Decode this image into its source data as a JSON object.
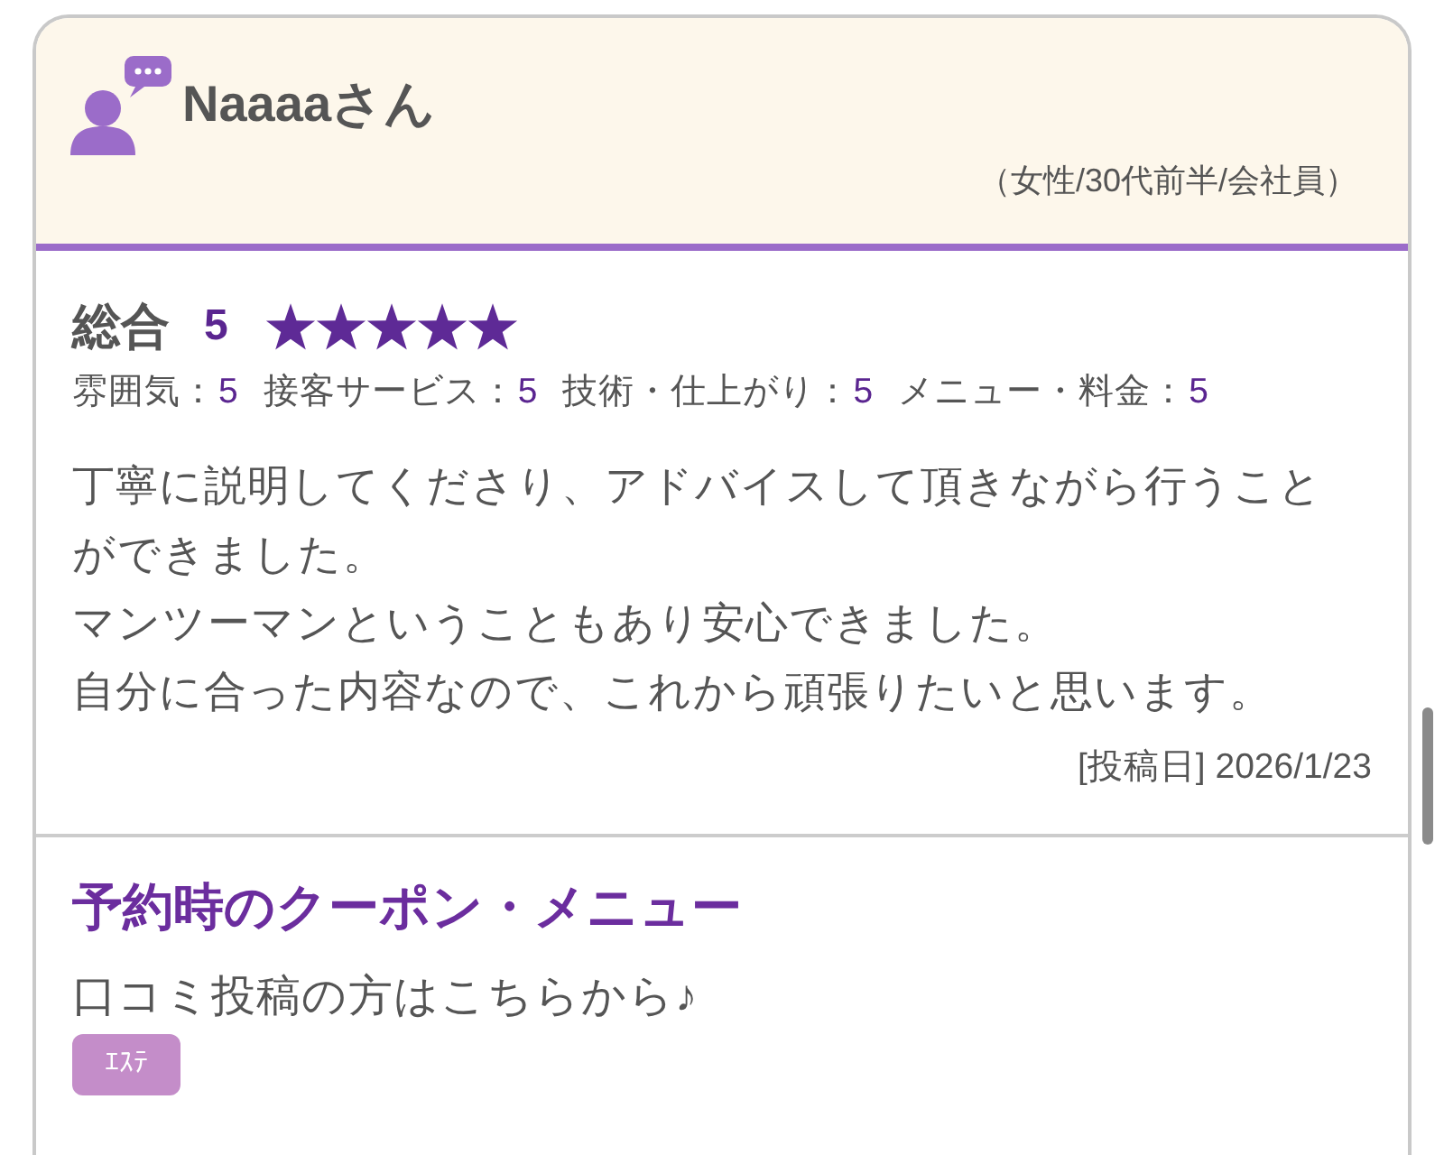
{
  "reviewer": {
    "name": "Naaaaさん",
    "profile": "（女性/30代前半/会社員）"
  },
  "rating": {
    "label": "総合",
    "score": "5",
    "stars": 5
  },
  "sub_ratings": [
    {
      "label": "雰囲気：",
      "score": "5"
    },
    {
      "label": "接客サービス：",
      "score": "5"
    },
    {
      "label": "技術・仕上がり：",
      "score": "5"
    },
    {
      "label": "メニュー・料金：",
      "score": "5"
    }
  ],
  "comment": [
    "丁寧に説明してくださり、アドバイスして頂きながら行うことができました。",
    "マンツーマンということもあり安心できました。",
    "自分に合った内容なので、これから頑張りたいと思います。"
  ],
  "posted": "[投稿日] 2026/1/23",
  "coupon": {
    "title": "予約時のクーポン・メニュー",
    "text": "口コミ投稿の方はこちらから♪",
    "tags": [
      "ｴｽﾃ"
    ]
  }
}
